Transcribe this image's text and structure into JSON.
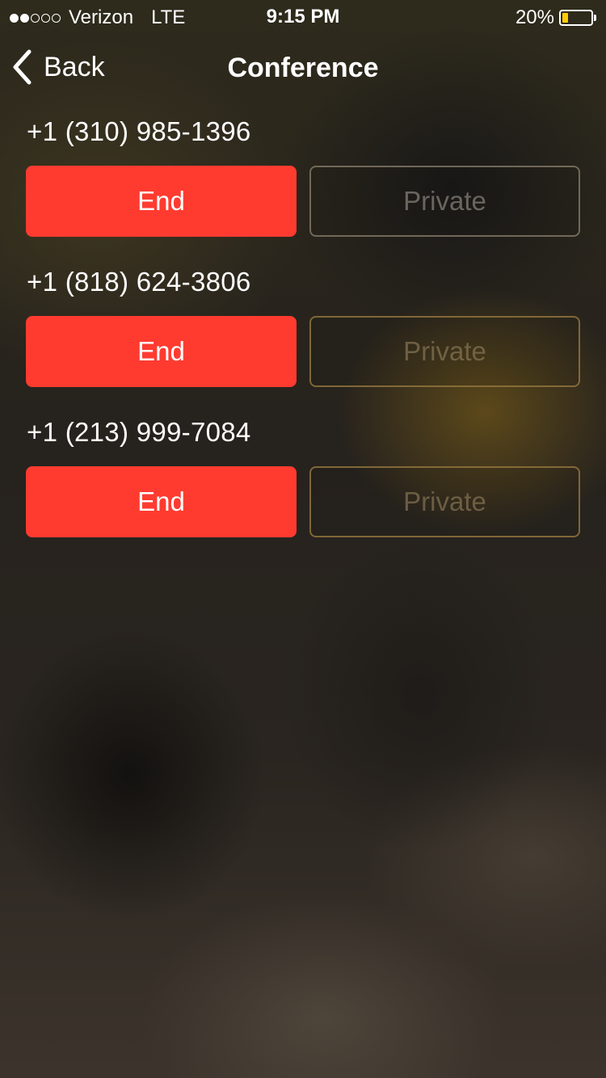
{
  "status_bar": {
    "signal_filled": 2,
    "signal_total": 5,
    "carrier": "Verizon",
    "network": "LTE",
    "time": "9:15 PM",
    "battery_percent": "20%",
    "battery_level": 0.2,
    "battery_color": "#ffcc00"
  },
  "nav": {
    "back_label": "Back",
    "back_icon": "chevron-left-icon",
    "title": "Conference"
  },
  "callers": [
    {
      "number": "+1 (310) 985-1396",
      "end_label": "End",
      "private_label": "Private"
    },
    {
      "number": "+1 (818) 624-3806",
      "end_label": "End",
      "private_label": "Private"
    },
    {
      "number": "+1 (213) 999-7084",
      "end_label": "End",
      "private_label": "Private"
    }
  ],
  "colors": {
    "end_button": "#ff3b30",
    "text": "#ffffff"
  }
}
